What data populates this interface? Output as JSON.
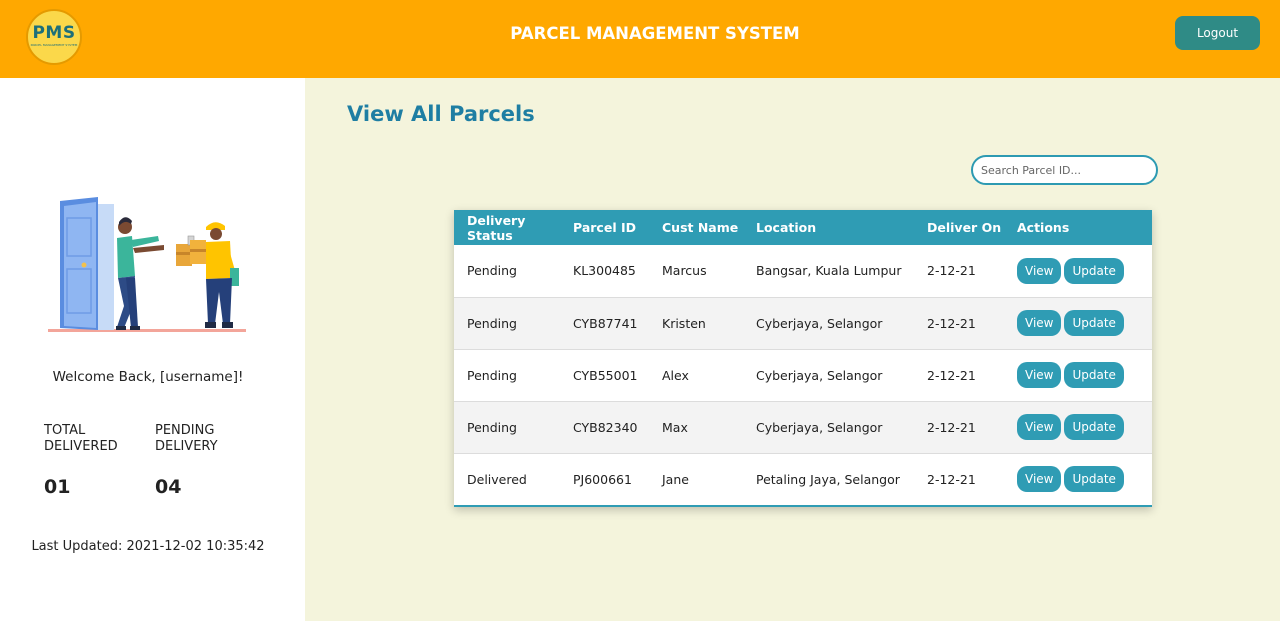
{
  "header": {
    "logo_text": "PMS",
    "logo_subtext": "PARCEL MANAGEMENT SYSTEM",
    "title": "PARCEL MANAGEMENT SYSTEM",
    "logout_label": "Logout"
  },
  "sidebar": {
    "welcome": "Welcome Back, [username]!",
    "stats": [
      {
        "label_line1": "TOTAL",
        "label_line2": "DELIVERED",
        "value": "01"
      },
      {
        "label_line1": "PENDING",
        "label_line2": "DELIVERY",
        "value": "04"
      }
    ],
    "last_updated": "Last Updated: 2021-12-02 10:35:42"
  },
  "main": {
    "title": "View All Parcels",
    "search_placeholder": "Search Parcel ID...",
    "table": {
      "headers": [
        "Delivery Status",
        "Parcel ID",
        "Cust Name",
        "Location",
        "Deliver On",
        "Actions"
      ],
      "rows": [
        {
          "status": "Pending",
          "parcel_id": "KL300485",
          "cust_name": "Marcus",
          "location": "Bangsar, Kuala Lumpur",
          "deliver_on": "2-12-21",
          "view": "View",
          "update": "Update"
        },
        {
          "status": "Pending",
          "parcel_id": "CYB87741",
          "cust_name": "Kristen",
          "location": "Cyberjaya, Selangor",
          "deliver_on": "2-12-21",
          "view": "View",
          "update": "Update"
        },
        {
          "status": "Pending",
          "parcel_id": "CYB55001",
          "cust_name": "Alex",
          "location": "Cyberjaya, Selangor",
          "deliver_on": "2-12-21",
          "view": "View",
          "update": "Update"
        },
        {
          "status": "Pending",
          "parcel_id": "CYB82340",
          "cust_name": "Max",
          "location": "Cyberjaya, Selangor",
          "deliver_on": "2-12-21",
          "view": "View",
          "update": "Update"
        },
        {
          "status": "Delivered",
          "parcel_id": "PJ600661",
          "cust_name": "Jane",
          "location": "Petaling Jaya, Selangor",
          "deliver_on": "2-12-21",
          "view": "View",
          "update": "Update"
        }
      ]
    }
  },
  "colors": {
    "header_bg": "#ffa800",
    "accent": "#2f9cb4",
    "logout_bg": "#2f8b86",
    "title_color": "#1e7ea3",
    "main_bg": "#f4f4dc"
  },
  "icons": {
    "illustration": "delivery-person-at-door-illustration"
  }
}
